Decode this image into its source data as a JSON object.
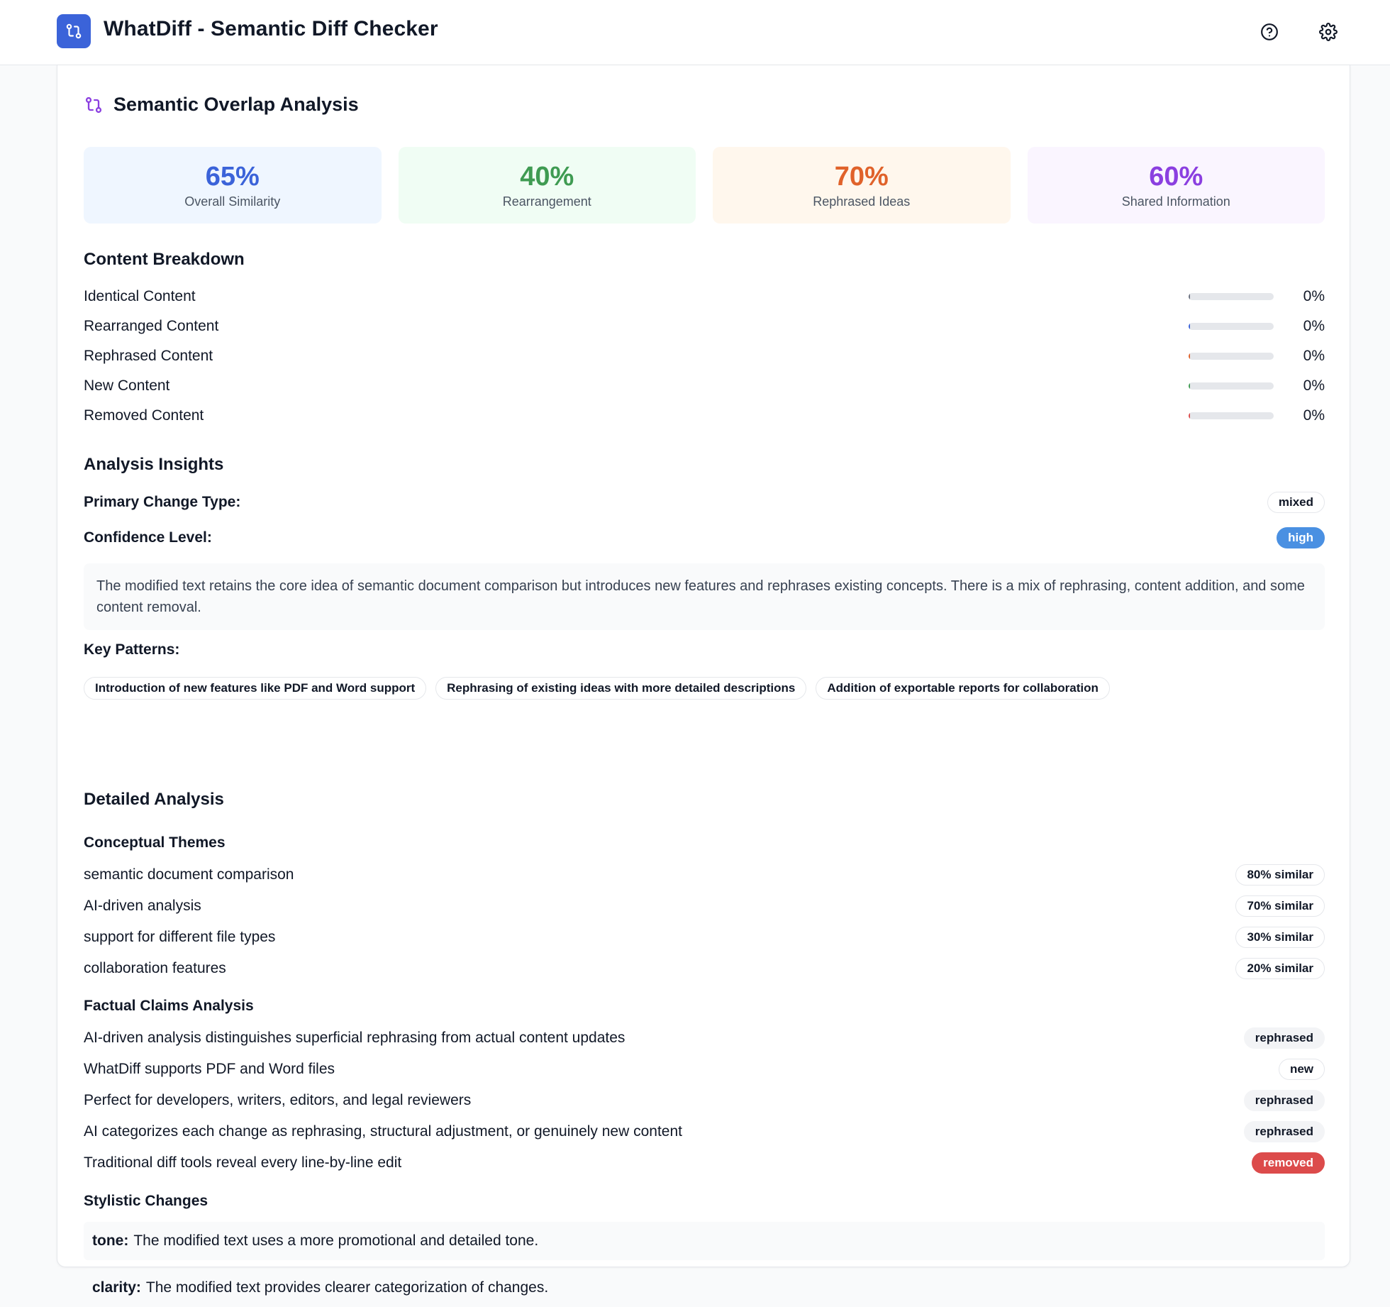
{
  "app": {
    "title": "WhatDiff - Semantic Diff Checker",
    "accent": "#3b63d9"
  },
  "header": {
    "icons": [
      "help-icon",
      "gear-icon"
    ]
  },
  "analysis": {
    "title": "Semantic Overlap Analysis",
    "stats": [
      {
        "value": "65%",
        "label": "Overall Similarity",
        "color": "#3b63d9",
        "bg": "#eff6ff"
      },
      {
        "value": "40%",
        "label": "Rearrangement",
        "color": "#3f9b52",
        "bg": "#f0fdf4"
      },
      {
        "value": "70%",
        "label": "Rephrased Ideas",
        "color": "#e0622a",
        "bg": "#fff7ed"
      },
      {
        "value": "60%",
        "label": "Shared Information",
        "color": "#8b3fe0",
        "bg": "#faf5ff"
      }
    ]
  },
  "breakdown": {
    "title": "Content Breakdown",
    "items": [
      {
        "label": "Identical Content",
        "pct": "0%",
        "value": 0,
        "color": "#6b7280"
      },
      {
        "label": "Rearranged Content",
        "pct": "0%",
        "value": 0,
        "color": "#3b63d9"
      },
      {
        "label": "Rephrased Content",
        "pct": "0%",
        "value": 0,
        "color": "#e0622a"
      },
      {
        "label": "New Content",
        "pct": "0%",
        "value": 0,
        "color": "#3f9b52"
      },
      {
        "label": "Removed Content",
        "pct": "0%",
        "value": 0,
        "color": "#dc4b4b"
      }
    ]
  },
  "insights": {
    "title": "Analysis Insights",
    "primary_label": "Primary Change Type:",
    "primary_value": "mixed",
    "confidence_label": "Confidence Level:",
    "confidence_value": "high",
    "summary": "The modified text retains the core idea of semantic document comparison but introduces new features and rephrases existing concepts. There is a mix of rephrasing, content addition, and some content removal.",
    "patterns_label": "Key Patterns:",
    "patterns": [
      "Introduction of new features like PDF and Word support",
      "Rephrasing of existing ideas with more detailed descriptions",
      "Addition of exportable reports for collaboration"
    ]
  },
  "detailed": {
    "title": "Detailed Analysis",
    "themes_title": "Conceptual Themes",
    "themes": [
      {
        "label": "semantic document comparison",
        "badge": "80% similar"
      },
      {
        "label": "AI-driven analysis",
        "badge": "70% similar"
      },
      {
        "label": "support for different file types",
        "badge": "30% similar"
      },
      {
        "label": "collaboration features",
        "badge": "20% similar"
      }
    ],
    "claims_title": "Factual Claims Analysis",
    "claims": [
      {
        "label": "AI-driven analysis distinguishes superficial rephrasing from actual content updates",
        "badge": "rephrased",
        "style": "gray"
      },
      {
        "label": "WhatDiff supports PDF and Word files",
        "badge": "new",
        "style": "outline"
      },
      {
        "label": "Perfect for developers, writers, editors, and legal reviewers",
        "badge": "rephrased",
        "style": "gray"
      },
      {
        "label": "AI categorizes each change as rephrasing, structural adjustment, or genuinely new content",
        "badge": "rephrased",
        "style": "gray"
      },
      {
        "label": "Traditional diff tools reveal every line-by-line edit",
        "badge": "removed",
        "style": "red"
      }
    ],
    "stylistic_title": "Stylistic Changes",
    "stylistic": [
      {
        "key": "tone:",
        "text": "The modified text uses a more promotional and detailed tone."
      },
      {
        "key": "clarity:",
        "text": "The modified text provides clearer categorization of changes."
      }
    ]
  }
}
